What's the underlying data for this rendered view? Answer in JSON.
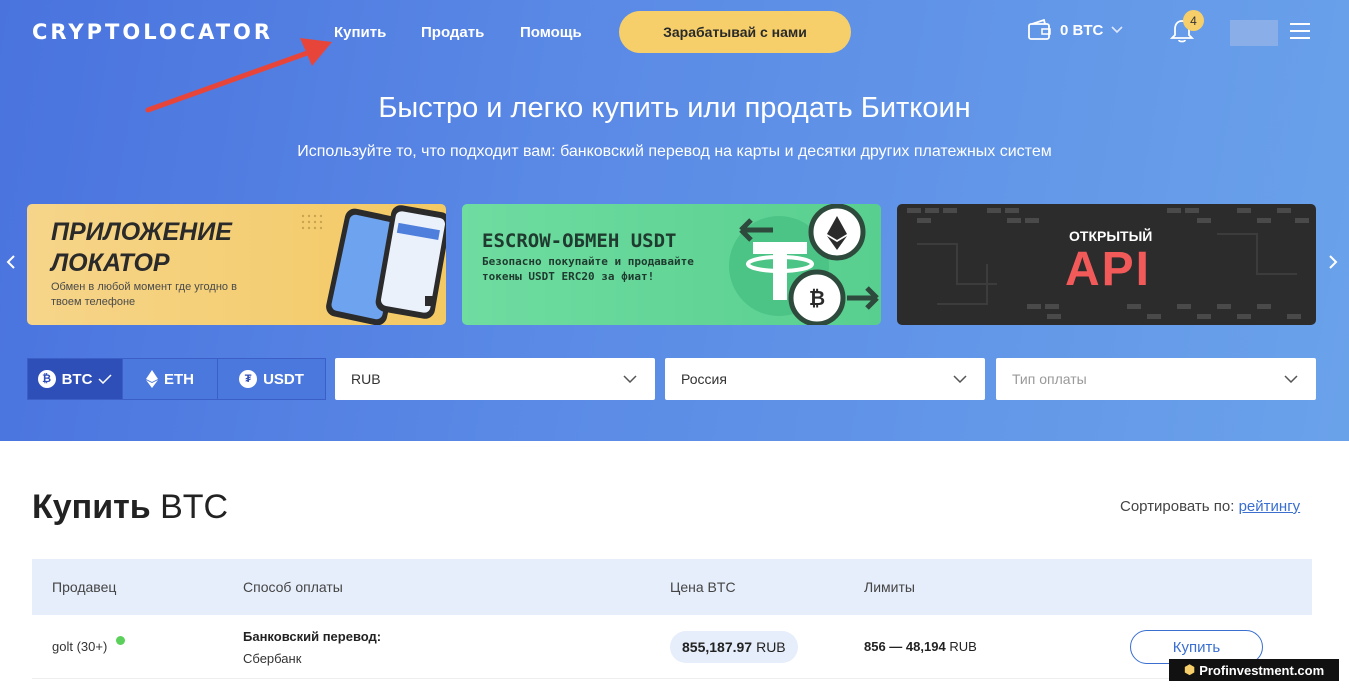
{
  "header": {
    "logo": "CRYPTOLOCATOR",
    "nav": [
      "Купить",
      "Продать",
      "Помощь"
    ],
    "earn_button": "Зарабатывай с нами",
    "wallet_balance": "0 BTC",
    "notifications_count": "4"
  },
  "hero": {
    "title": "Быстро и легко купить или продать Биткоин",
    "subtitle": "Используйте то, что подходит вам: банковский перевод на карты и десятки других платежных систем"
  },
  "slides": [
    {
      "line1": "ПРИЛОЖЕНИЕ",
      "line2": "ЛОКАТОР",
      "text": "Обмен в любой момент где угодно в твоем телефоне"
    },
    {
      "title": "ESCROW-ОБМЕН USDT",
      "text": "Безопасно покупайте и продавайте токены USDT ERC20 за фиат!"
    },
    {
      "small": "ОТКРЫТЫЙ",
      "big": "API"
    }
  ],
  "filters": {
    "coins": [
      "BTC",
      "ETH",
      "USDT"
    ],
    "active_coin": "BTC",
    "currency": "RUB",
    "country": "Россия",
    "payment_placeholder": "Тип оплаты"
  },
  "section": {
    "title_bold": "Купить",
    "title_rest": "BTC",
    "sort_label": "Сортировать по:",
    "sort_value": "рейтингу"
  },
  "table": {
    "headers": [
      "Продавец",
      "Способ оплаты",
      "Цена BTC",
      "Лимиты"
    ],
    "rows": [
      {
        "seller": "golt (30+)",
        "method": "Банковский перевод:",
        "bank": "Сбербанк",
        "price": "855,187.97",
        "price_currency": "RUB",
        "limits": "856 — 48,194",
        "limits_currency": "RUB",
        "action": "Купить"
      }
    ]
  },
  "watermark": "Profinvestment.com",
  "colors": {
    "accent": "#3a6fd0",
    "earn_button": "#f6cf6a",
    "online": "#5bd05b"
  }
}
